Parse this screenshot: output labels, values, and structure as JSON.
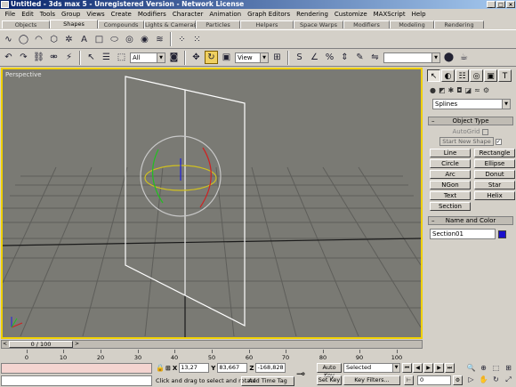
{
  "window": {
    "title": "Untitled - 3ds max 5 - Unregistered Version - Network License",
    "buttons": [
      "_",
      "□",
      "×"
    ]
  },
  "menu": [
    "File",
    "Edit",
    "Tools",
    "Group",
    "Views",
    "Create",
    "Modifiers",
    "Character",
    "Animation",
    "Graph Editors",
    "Rendering",
    "Customize",
    "MAXScript",
    "Help"
  ],
  "tabs": [
    "Objects",
    "Shapes",
    "Compounds",
    "Lights & Cameras",
    "Particles",
    "Helpers",
    "Space Warps",
    "Modifiers",
    "Modeling",
    "Rendering"
  ],
  "toolbar": {
    "selection_filter": "All",
    "ref_coord": "View",
    "named_selection": ""
  },
  "viewport": {
    "label": "Perspective",
    "border_color": "#f0d000",
    "bg_color": "#7a7a74"
  },
  "command_panel": {
    "category_dropdown": "Splines",
    "object_type_title": "Object Type",
    "autogrid_label": "AutoGrid",
    "start_new_shape_label": "Start New Shape",
    "start_new_shape_checked": "✓",
    "shapes": [
      "Line",
      "Rectangle",
      "Circle",
      "Ellipse",
      "Arc",
      "Donut",
      "NGon",
      "Star",
      "Text",
      "Helix",
      "Section"
    ],
    "name_color_title": "Name and Color",
    "object_name": "Section01",
    "object_color": "#1a10cc"
  },
  "timeslider": {
    "label": "0 / 100",
    "left_arrow": "<",
    "right_arrow": ">"
  },
  "trackbar": {
    "ticks": [
      "0",
      "10",
      "20",
      "30",
      "40",
      "50",
      "60",
      "70",
      "80",
      "90",
      "100"
    ]
  },
  "status": {
    "x_label": "X",
    "x_value": "13,27",
    "y_label": "Y",
    "y_value": "83,667",
    "z_label": "Z",
    "z_value": "-168,828",
    "help_text": "Click and drag to select and rotate",
    "add_time_tag": "Add Time Tag",
    "auto_key": "Auto Key",
    "set_key": "Set Key",
    "selection_mode": "Selected",
    "key_filters": "Key Filters...",
    "current_frame": "0"
  }
}
